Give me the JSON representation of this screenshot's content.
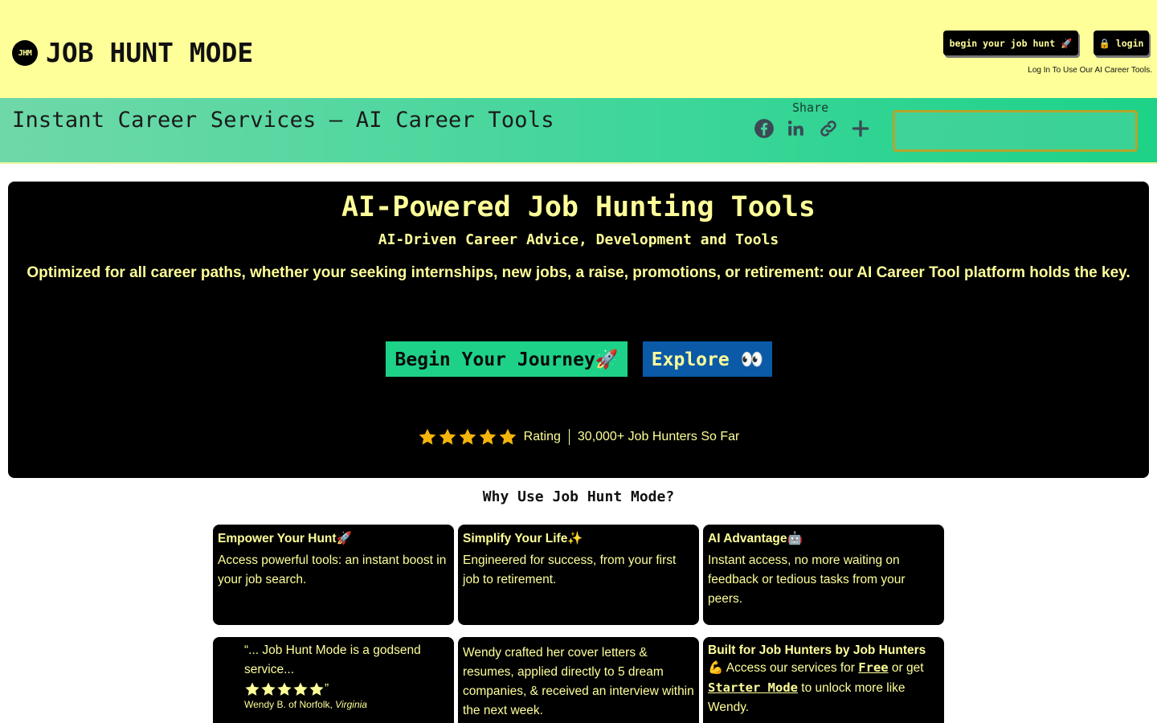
{
  "header": {
    "logo_badge": "JHM",
    "logo_text": "JOB HUNT MODE",
    "begin_button": "begin your job hunt 🚀",
    "login_button": "🔒 login",
    "login_note": "Log In To Use Our AI Career Tools."
  },
  "banner": {
    "title": "Instant Career Services – AI Career Tools",
    "share_label": "Share",
    "share_icons": [
      "facebook-icon",
      "linkedin-icon",
      "link-icon",
      "plus-icon"
    ]
  },
  "hero": {
    "title": "AI-Powered Job Hunting Tools",
    "subtitle": "AI-Driven Career Advice, Development and Tools",
    "description": "Optimized for all career paths, whether your seeking internships, new jobs, a raise, promotions, or retirement: our AI Career Tool platform holds the key.",
    "cta_begin": "Begin Your Journey🚀",
    "cta_explore": "Explore 👀",
    "rating_stars": 5,
    "rating_label": "Rating",
    "rating_count": "30,000+ Job Hunters So Far"
  },
  "why": {
    "title": "Why Use Job Hunt Mode?",
    "cards": [
      {
        "heading": "Empower Your Hunt🚀",
        "body": "Access powerful tools: an instant boost in your job search."
      },
      {
        "heading": "Simplify Your Life✨",
        "body": "Engineered for success, from your first job to retirement."
      },
      {
        "heading": "AI Advantage🤖",
        "body": "Instant access, no more waiting on feedback or tedious tasks from your peers."
      }
    ],
    "testimonial": {
      "quote_open": "“... Job Hunt Mode is a godsend service...",
      "quote_close": "”",
      "stars": 5,
      "author": "Wendy B. of Norfolk,",
      "location": "Virginia"
    },
    "story": "Wendy crafted her cover letters & resumes, applied directly to 5 dream companies, & received an interview within the next week.",
    "built": {
      "heading": "Built for Job Hunters by Job Hunters",
      "pre": "💪 Access our services for",
      "free_link": "Free",
      "mid": "or get",
      "starter_link": "Starter Mode",
      "post": "to unlock more like Wendy."
    }
  },
  "colors": {
    "accent_yellow": "#ffff99",
    "brand_green": "#1dd288",
    "explore_blue": "#0a5aa8",
    "star_gold": "#f5b50a"
  }
}
